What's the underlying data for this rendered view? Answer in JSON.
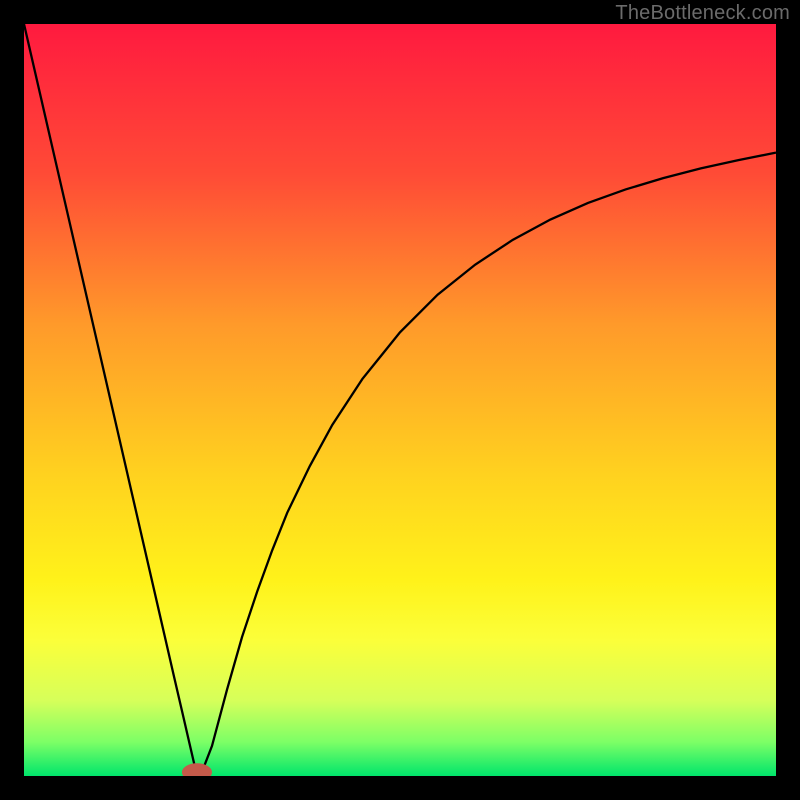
{
  "attribution": "TheBottleneck.com",
  "chart_data": {
    "type": "line",
    "title": "",
    "xlabel": "",
    "ylabel": "",
    "xlim": [
      0,
      100
    ],
    "ylim": [
      0,
      100
    ],
    "grid": false,
    "legend": false,
    "gradient_stops": [
      {
        "offset": 0.0,
        "color": "#ff1a3f"
      },
      {
        "offset": 0.2,
        "color": "#ff4b36"
      },
      {
        "offset": 0.4,
        "color": "#ff9a2a"
      },
      {
        "offset": 0.6,
        "color": "#ffd21f"
      },
      {
        "offset": 0.74,
        "color": "#fff21a"
      },
      {
        "offset": 0.82,
        "color": "#fbff3a"
      },
      {
        "offset": 0.9,
        "color": "#d6ff5a"
      },
      {
        "offset": 0.955,
        "color": "#7cff66"
      },
      {
        "offset": 1.0,
        "color": "#00e56b"
      }
    ],
    "marker": {
      "x": 23,
      "y": 0.5,
      "color": "#c45a4a",
      "rx": 2.0,
      "ry": 1.2
    },
    "series": [
      {
        "name": "curve",
        "color": "#000000",
        "stroke_width": 2.3,
        "x": [
          0,
          2,
          4,
          6,
          8,
          10,
          12,
          14,
          16,
          18,
          20,
          21,
          22,
          22.8,
          23.8,
          25,
          27,
          29,
          31,
          33,
          35,
          38,
          41,
          45,
          50,
          55,
          60,
          65,
          70,
          75,
          80,
          85,
          90,
          95,
          100
        ],
        "y": [
          100,
          91.3,
          82.6,
          73.9,
          65.2,
          56.5,
          47.8,
          39.1,
          30.4,
          21.7,
          13.0,
          8.7,
          4.35,
          0.9,
          0.9,
          4.0,
          11.5,
          18.5,
          24.5,
          30.0,
          35.0,
          41.2,
          46.7,
          52.8,
          59.0,
          64.0,
          68.0,
          71.3,
          74.0,
          76.2,
          78.0,
          79.5,
          80.8,
          81.9,
          82.9
        ]
      }
    ]
  }
}
